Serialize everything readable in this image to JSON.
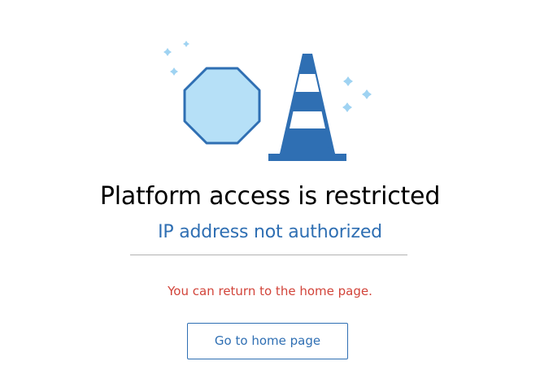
{
  "illustration": {
    "icons": [
      "stop-sign-icon",
      "traffic-cone-icon",
      "sparkle-icon"
    ],
    "colors": {
      "primary": "#2f6fb3",
      "light_fill": "#b6e0f7",
      "sparkle": "#9fd3f2"
    }
  },
  "heading": {
    "title": "Platform access is restricted",
    "subtitle": "IP address not authorized"
  },
  "body": {
    "message": "You can return to the home page."
  },
  "actions": {
    "home_button_label": "Go to home page"
  },
  "colors": {
    "accent": "#2f6fb3",
    "error": "#d2443a",
    "divider": "#b3b3b3"
  }
}
